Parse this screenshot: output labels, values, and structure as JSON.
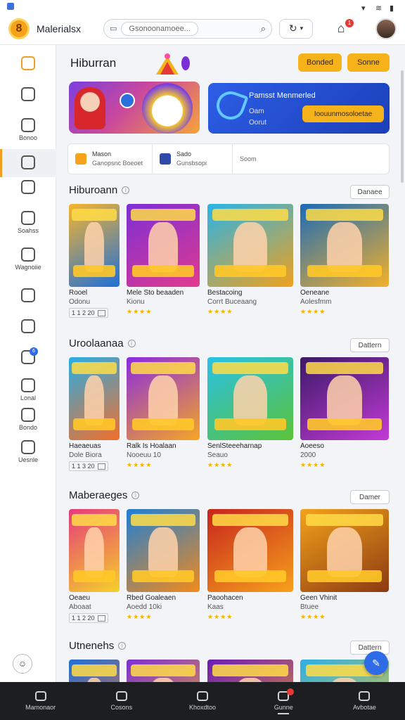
{
  "app": {
    "name": "Malerialsx"
  },
  "search": {
    "placeholder": "Gsonoonamoee..."
  },
  "header": {
    "cart_count": "1"
  },
  "sidebar": {
    "items": [
      {
        "label": "",
        "icon": "home-icon"
      },
      {
        "label": "",
        "icon": "grid-icon"
      },
      {
        "label": "Bonoo",
        "icon": "tag-icon"
      },
      {
        "label": "",
        "icon": "calculator-icon"
      },
      {
        "label": "",
        "icon": "store-icon"
      },
      {
        "label": "Soahss",
        "icon": "pencil-icon"
      },
      {
        "label": "Wagnoiie",
        "icon": "comment-icon"
      },
      {
        "label": "",
        "icon": "clock-icon"
      },
      {
        "label": "",
        "icon": "box-icon"
      },
      {
        "label": "",
        "icon": "message-icon",
        "badge": "6"
      },
      {
        "label": "Lonal",
        "icon": "card-icon"
      },
      {
        "label": "Bondo",
        "icon": "gift-icon"
      },
      {
        "label": "Uesnle",
        "icon": "settings-icon"
      }
    ]
  },
  "page": {
    "title": "Hiburran",
    "btn1": "Bonded",
    "btn2": "Sonne"
  },
  "banner2": {
    "title": "Pamsst Menmerled",
    "line1": "Oam",
    "line2": "Oorut",
    "cta": "Ioouunmosoloetae"
  },
  "infobar": {
    "cells": [
      {
        "title": "Mason",
        "sub": "Ganopsnc Boeoet"
      },
      {
        "title": "Sado",
        "sub": "Gunsbsopi"
      },
      {
        "title": "",
        "sub": "Soom"
      }
    ]
  },
  "sections": [
    {
      "title": "Hiburoann",
      "button": "Danaee",
      "games": [
        {
          "title": "Rooel",
          "sub": "Odonu",
          "meta": "1 1 2 20",
          "stars": "",
          "colors": [
            "#f7b52c",
            "#1e6fd9"
          ]
        },
        {
          "title": "Mele Sto beaaden",
          "sub": "Kionu",
          "meta": "",
          "stars": "★★★★",
          "colors": [
            "#7b2fd6",
            "#e23a8e"
          ]
        },
        {
          "title": "Bestacoing",
          "sub": "Corrt Buceaang",
          "meta": "",
          "stars": "★★★★",
          "colors": [
            "#2ab4e8",
            "#f0a11c"
          ]
        },
        {
          "title": "Oeneane",
          "sub": "Aolesfmm",
          "meta": "",
          "stars": "★★★★",
          "colors": [
            "#1a6bb8",
            "#f3b02b"
          ]
        }
      ]
    },
    {
      "title": "Uroolaanaa",
      "button": "Dattern",
      "games": [
        {
          "title": "Haeaeuas",
          "sub": "Dole Biora",
          "meta": "1 1 3 20",
          "stars": "",
          "colors": [
            "#2aaee6",
            "#f36e2a"
          ]
        },
        {
          "title": "Ralk Is Hoalaan",
          "sub": "Nooeuu 10",
          "meta": "",
          "stars": "★★★★",
          "colors": [
            "#8a2be2",
            "#f5a623"
          ]
        },
        {
          "title": "SenlSteeeharnap",
          "sub": "Seauo",
          "meta": "",
          "stars": "★★★★",
          "colors": [
            "#29c1e8",
            "#5bc236"
          ]
        },
        {
          "title": "Aoeeso",
          "sub": "2000",
          "meta": "",
          "stars": "★★★★",
          "colors": [
            "#3b1a66",
            "#c23ad6"
          ]
        }
      ]
    },
    {
      "title": "Maberaeges",
      "button": "Damer",
      "games": [
        {
          "title": "Oeaeu",
          "sub": "Aboaat",
          "meta": "1 1 2 20",
          "stars": "",
          "colors": [
            "#e63b7a",
            "#f5d12a"
          ]
        },
        {
          "title": "Rbed Goaleaen",
          "sub": "Aoedd 10ki",
          "meta": "",
          "stars": "★★★★",
          "colors": [
            "#1e7fd6",
            "#f28a1a"
          ]
        },
        {
          "title": "Paoohacen",
          "sub": "Kaas",
          "meta": "",
          "stars": "★★★★",
          "colors": [
            "#c7241c",
            "#f6a11c"
          ]
        },
        {
          "title": "Geen Vhinit",
          "sub": "Btuee",
          "meta": "",
          "stars": "★★★★",
          "colors": [
            "#f3a21a",
            "#8b3a12"
          ]
        }
      ]
    },
    {
      "title": "Utnenehs",
      "button": "Dattern",
      "games": [
        {
          "title": "",
          "sub": "",
          "meta": "",
          "stars": "",
          "colors": [
            "#1e6fd9",
            "#f36e2a"
          ]
        },
        {
          "title": "",
          "sub": "",
          "meta": "",
          "stars": "",
          "colors": [
            "#7b2fd6",
            "#f6b21a"
          ]
        },
        {
          "title": "",
          "sub": "",
          "meta": "",
          "stars": "",
          "colors": [
            "#6a1bb8",
            "#f0a020"
          ]
        },
        {
          "title": "",
          "sub": "",
          "meta": "",
          "stars": "",
          "colors": [
            "#2aaee6",
            "#f7c92a"
          ]
        }
      ]
    }
  ],
  "bottom_nav": [
    {
      "label": "Mamonaor",
      "icon": "compass-icon"
    },
    {
      "label": "Cosons",
      "icon": "flag-icon"
    },
    {
      "label": "Khoxdtoo",
      "icon": "home-icon"
    },
    {
      "label": "Gunne",
      "icon": "chat-icon",
      "badge": true
    },
    {
      "label": "Avbotae",
      "icon": "clock-icon"
    }
  ],
  "colors": {
    "accent": "#f6b21a",
    "primary": "#2e6be6",
    "nav_bg": "#1d1e22"
  }
}
